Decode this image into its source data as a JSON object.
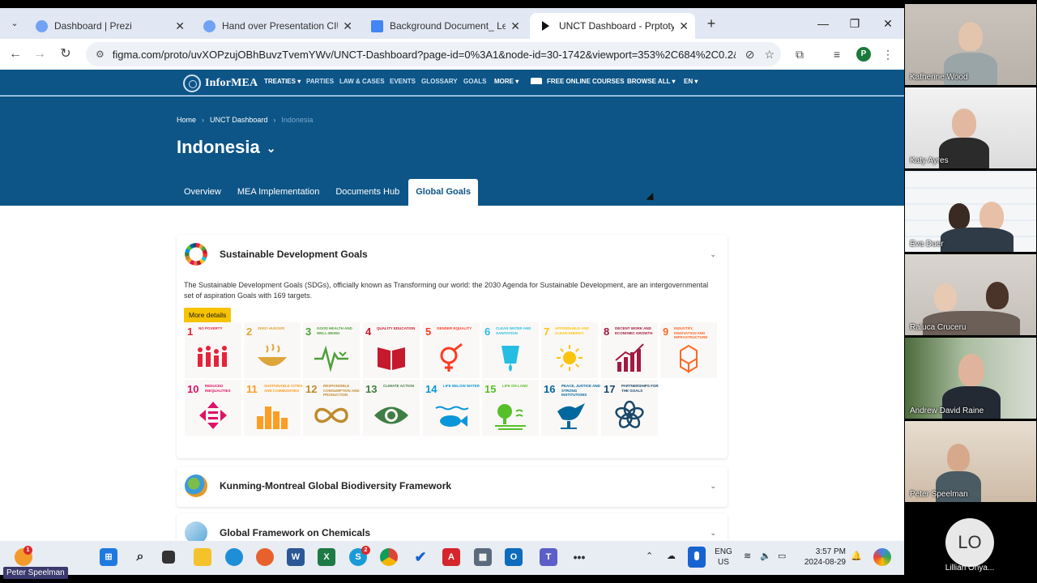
{
  "browser": {
    "tabs": [
      {
        "title": "Dashboard | Prezi",
        "icon": "globe-icon"
      },
      {
        "title": "Hand over Presentation CIU Au",
        "icon": "globe-icon"
      },
      {
        "title": "Background Document_ Learni",
        "icon": "docs-icon"
      },
      {
        "title": "UNCT Dashboard - Prptotype",
        "icon": "figma-play-icon"
      }
    ],
    "url": "figma.com/proto/uvXOPzujOBhBuvzTvemYWv/UNCT-Dashboard?page-id=0%3A1&node-id=30-1742&viewport=353%2C684%2C0.2&t=yZ...",
    "profile_initial": "P"
  },
  "site": {
    "logo": "InforMEA",
    "nav": [
      "TREATIES ▾",
      "PARTIES",
      "LAW & CASES",
      "EVENTS",
      "GLOSSARY",
      "GOALS",
      "MORE ▾",
      "FREE ONLINE COURSES",
      "BROWSE ALL ▾",
      "EN ▾"
    ],
    "breadcrumb": [
      "Home",
      "UNCT Dashboard",
      "Indonesia"
    ],
    "country": "Indonesia",
    "tabs": [
      "Overview",
      "MEA Implementation",
      "Documents Hub",
      "Global Goals"
    ],
    "active_tab": "Global Goals"
  },
  "sections": {
    "sdg": {
      "title": "Sustainable Development Goals",
      "description": "The Sustainable Development Goals (SDGs), officially known as Transforming our world: the 2030 Agenda for Sustainable Development, are an intergovernmental set of aspiration Goals with 169 targets.",
      "button": "More details"
    },
    "gbf": {
      "title": "Kunming-Montreal Global Biodiversity Framework"
    },
    "chem": {
      "title": "Global Framework on Chemicals"
    }
  },
  "sdg_goals": [
    {
      "num": "1",
      "label": "No poverty",
      "color": "#e5243b",
      "icon": "family-icon"
    },
    {
      "num": "2",
      "label": "Zero hunger",
      "color": "#dda63a",
      "icon": "bowl-icon"
    },
    {
      "num": "3",
      "label": "Good health and well-being",
      "color": "#4c9f38",
      "icon": "heartbeat-icon"
    },
    {
      "num": "4",
      "label": "Quality education",
      "color": "#c5192d",
      "icon": "book-icon"
    },
    {
      "num": "5",
      "label": "Gender equality",
      "color": "#ff3a21",
      "icon": "gender-icon"
    },
    {
      "num": "6",
      "label": "Clean water and sanitation",
      "color": "#26bde2",
      "icon": "water-drop-icon"
    },
    {
      "num": "7",
      "label": "Affordable and clean energy",
      "color": "#fcc30b",
      "icon": "sun-icon"
    },
    {
      "num": "8",
      "label": "Decent work and economic growth",
      "color": "#a21942",
      "icon": "growth-chart-icon"
    },
    {
      "num": "9",
      "label": "Industry, innovation and infrastructure",
      "color": "#fd6925",
      "icon": "cubes-icon"
    },
    {
      "num": "10",
      "label": "Reduced inequalities",
      "color": "#dd1367",
      "icon": "arrows-icon"
    },
    {
      "num": "11",
      "label": "Sustainable cities and communities",
      "color": "#fd9d24",
      "icon": "city-icon"
    },
    {
      "num": "12",
      "label": "Responsible consumption and production",
      "color": "#bf8b2e",
      "icon": "infinity-icon"
    },
    {
      "num": "13",
      "label": "Climate action",
      "color": "#3f7e44",
      "icon": "eye-globe-icon"
    },
    {
      "num": "14",
      "label": "Life below water",
      "color": "#0a97d9",
      "icon": "fish-icon"
    },
    {
      "num": "15",
      "label": "Life on land",
      "color": "#56c02b",
      "icon": "tree-icon"
    },
    {
      "num": "16",
      "label": "Peace, justice and strong institutions",
      "color": "#00689d",
      "icon": "dove-icon"
    },
    {
      "num": "17",
      "label": "Partnerships for the goals",
      "color": "#19486a",
      "icon": "flower-icon"
    }
  ],
  "taskbar": {
    "lang": [
      "ENG",
      "US"
    ],
    "time": "3:57 PM",
    "date": "2024-08-29",
    "weather_badge": "1",
    "skype_badge": "2"
  },
  "meeting": {
    "participants": [
      "Katherine Wood",
      "Katy Ayres",
      "Eva Duer",
      "Raluca Cruceru",
      "Andrew David Raine",
      "Peter Speelman"
    ],
    "audio_only": {
      "initials": "LO",
      "name": "Lillian Onya..."
    },
    "self_label": "Peter Speelman"
  }
}
